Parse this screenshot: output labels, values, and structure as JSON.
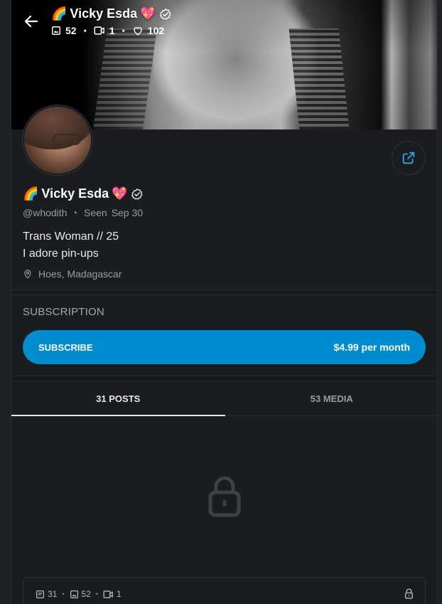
{
  "header": {
    "name": "Vicky Esda",
    "name_prefix_emoji": "🌈",
    "name_suffix_emoji": "💖",
    "photos_count": "52",
    "videos_count": "1",
    "likes_count": "102"
  },
  "profile": {
    "name": "Vicky Esda",
    "name_prefix_emoji": "🌈",
    "name_suffix_emoji": "💖",
    "handle": "@whodith",
    "seen_label": "Seen",
    "seen_date": "Sep 30",
    "bio_line_1": "Trans Woman // 25",
    "bio_line_2": "I adore pin-ups",
    "location": "Hoes, Madagascar"
  },
  "subscription": {
    "section_title": "SUBSCRIPTION",
    "button_label": "SUBSCRIBE",
    "price": "$4.99 per month"
  },
  "tabs": [
    {
      "label": "31 POSTS",
      "active": true
    },
    {
      "label": "53 MEDIA",
      "active": false
    }
  ],
  "summary": {
    "posts_count": "31",
    "photos_count": "52",
    "videos_count": "1"
  },
  "colors": {
    "accent": "#008ccf",
    "background": "#1b1c1f"
  }
}
